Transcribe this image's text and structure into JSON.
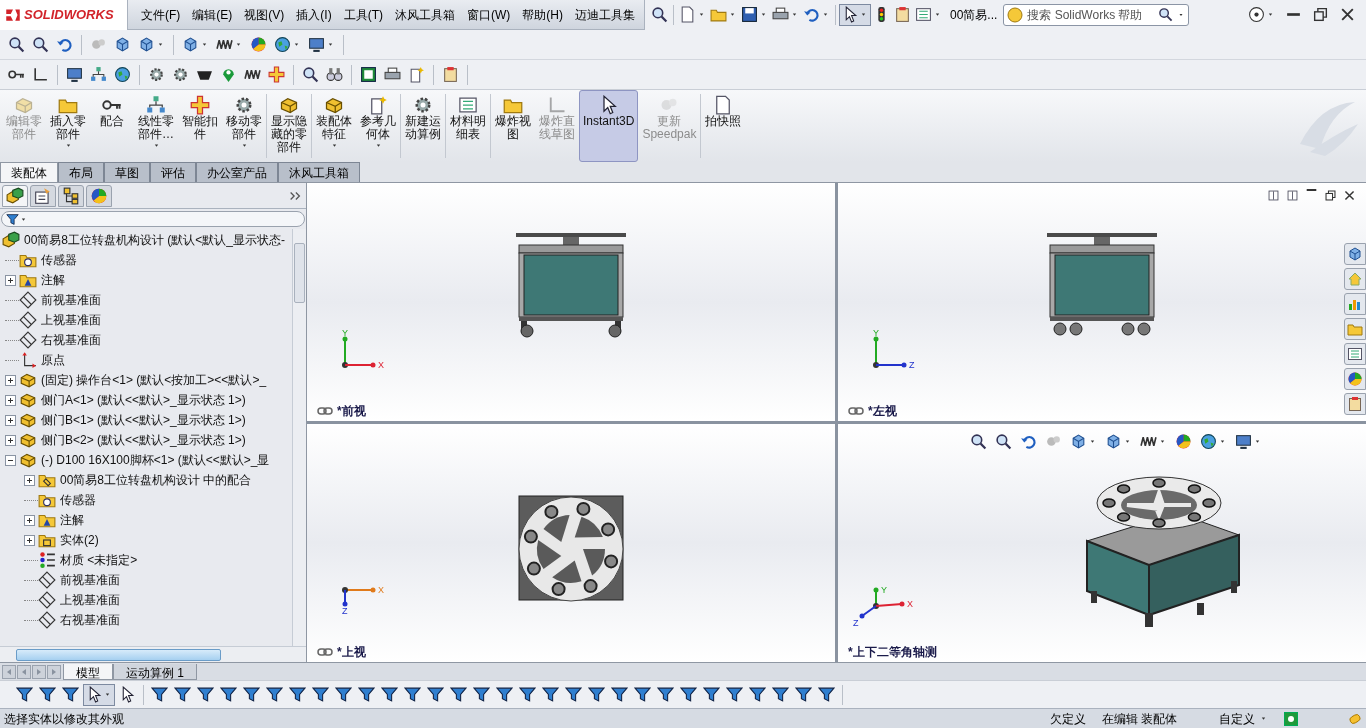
{
  "app": {
    "logo": "SOLIDWORKS"
  },
  "menu": [
    {
      "label": "文件(F)"
    },
    {
      "label": "编辑(E)"
    },
    {
      "label": "视图(V)"
    },
    {
      "label": "插入(I)"
    },
    {
      "label": "工具(T)"
    },
    {
      "label": "沐风工具箱"
    },
    {
      "label": "窗口(W)"
    },
    {
      "label": "帮助(H)"
    },
    {
      "label": "迈迪工具集"
    }
  ],
  "document_title": "00简易...",
  "search": {
    "placeholder": "搜索 SolidWorks 帮助"
  },
  "command_groups": [
    [
      {
        "lines": [
          "编辑零",
          "部件"
        ],
        "disabled": true,
        "dropdown": false,
        "selected": false
      },
      {
        "lines": [
          "插入零",
          "部件"
        ],
        "disabled": false,
        "dropdown": true,
        "selected": false
      },
      {
        "lines": [
          "配合"
        ],
        "disabled": false,
        "dropdown": false,
        "selected": false
      },
      {
        "lines": [
          "线性零",
          "部件…"
        ],
        "disabled": false,
        "dropdown": true,
        "selected": false
      },
      {
        "lines": [
          "智能扣",
          "件"
        ],
        "disabled": false,
        "dropdown": false,
        "selected": false
      },
      {
        "lines": [
          "移动零",
          "部件"
        ],
        "disabled": false,
        "dropdown": true,
        "selected": false
      }
    ],
    [
      {
        "lines": [
          "显示隐",
          "藏的零",
          "部件"
        ],
        "disabled": false,
        "dropdown": false,
        "selected": false
      }
    ],
    [
      {
        "lines": [
          "装配体",
          "特征"
        ],
        "disabled": false,
        "dropdown": true,
        "selected": false
      },
      {
        "lines": [
          "参考几",
          "何体"
        ],
        "disabled": false,
        "dropdown": true,
        "selected": false
      }
    ],
    [
      {
        "lines": [
          "新建运",
          "动算例"
        ],
        "disabled": false,
        "dropdown": false,
        "selected": false
      }
    ],
    [
      {
        "lines": [
          "材料明",
          "细表"
        ],
        "disabled": false,
        "dropdown": false,
        "selected": false
      }
    ],
    [
      {
        "lines": [
          "爆炸视",
          "图"
        ],
        "disabled": false,
        "dropdown": false,
        "selected": false
      },
      {
        "lines": [
          "爆炸直",
          "线草图"
        ],
        "disabled": true,
        "dropdown": false,
        "selected": false
      },
      {
        "lines": [
          "Instant3D"
        ],
        "disabled": false,
        "dropdown": false,
        "selected": true
      },
      {
        "lines": [
          "更新",
          "Speedpak"
        ],
        "disabled": true,
        "dropdown": false,
        "selected": false
      }
    ],
    [
      {
        "lines": [
          "拍快照"
        ],
        "disabled": false,
        "dropdown": false,
        "selected": false
      }
    ]
  ],
  "panel_tabs": [
    {
      "selected": true
    },
    {
      "selected": false
    },
    {
      "selected": false
    },
    {
      "selected": false
    }
  ],
  "tabs": [
    {
      "label": "装配体",
      "selected": true
    },
    {
      "label": "布局",
      "selected": false
    },
    {
      "label": "草图",
      "selected": false
    },
    {
      "label": "评估",
      "selected": false
    },
    {
      "label": "办公室产品",
      "selected": false
    },
    {
      "label": "沐风工具箱",
      "selected": false
    }
  ],
  "tree": {
    "label": "00简易8工位转盘机构设计  (默认<默认_显示状态-",
    "kind": "assembly",
    "children": [
      {
        "label": "传感器",
        "kind": "sensor"
      },
      {
        "label": "注解",
        "kind": "annotation",
        "expanded": false
      },
      {
        "label": "前视基准面",
        "kind": "plane"
      },
      {
        "label": "上视基准面",
        "kind": "plane"
      },
      {
        "label": "右视基准面",
        "kind": "plane"
      },
      {
        "label": "原点",
        "kind": "origin"
      },
      {
        "label": "(固定) 操作台<1> (默认<按加工><<默认>_",
        "kind": "part",
        "expanded": false
      },
      {
        "label": "侧门A<1> (默认<<默认>_显示状态 1>)",
        "kind": "part",
        "expanded": false
      },
      {
        "label": "侧门B<1> (默认<<默认>_显示状态 1>)",
        "kind": "part",
        "expanded": false
      },
      {
        "label": "侧门B<2> (默认<<默认>_显示状态 1>)",
        "kind": "part",
        "expanded": false
      },
      {
        "label": "(-) D100 16X100脚杯<1> (默认<<默认>_显",
        "kind": "part",
        "expanded": true,
        "children": [
          {
            "label": "00简易8工位转盘机构设计 中的配合",
            "kind": "mates",
            "expanded": false
          },
          {
            "label": "传感器",
            "kind": "sensor"
          },
          {
            "label": "注解",
            "kind": "annotation",
            "expanded": false
          },
          {
            "label": "实体(2)",
            "kind": "bodies",
            "expanded": false
          },
          {
            "label": "材质 <未指定>",
            "kind": "material"
          },
          {
            "label": "前视基准面",
            "kind": "plane"
          },
          {
            "label": "上视基准面",
            "kind": "plane"
          },
          {
            "label": "右视基准面",
            "kind": "plane"
          }
        ]
      }
    ]
  },
  "viewports": [
    {
      "label": "*前视",
      "kind": "front",
      "axes": [
        "Y",
        "X"
      ]
    },
    {
      "label": "*左视",
      "kind": "left",
      "axes": [
        "Y",
        "Z"
      ]
    },
    {
      "label": "*上视",
      "kind": "top",
      "axes": [
        "X",
        "Z"
      ]
    },
    {
      "label": "*上下二等角轴测",
      "kind": "iso",
      "axes": [
        "Y",
        "X",
        "Z"
      ]
    }
  ],
  "bottom_tabs": [
    {
      "label": "模型",
      "selected": true
    },
    {
      "label": "运动算例 1",
      "selected": false
    }
  ],
  "status_bar": {
    "message": "选择实体以修改其外观",
    "state": "欠定义",
    "mode": "在编辑 装配体",
    "units": "自定义"
  }
}
